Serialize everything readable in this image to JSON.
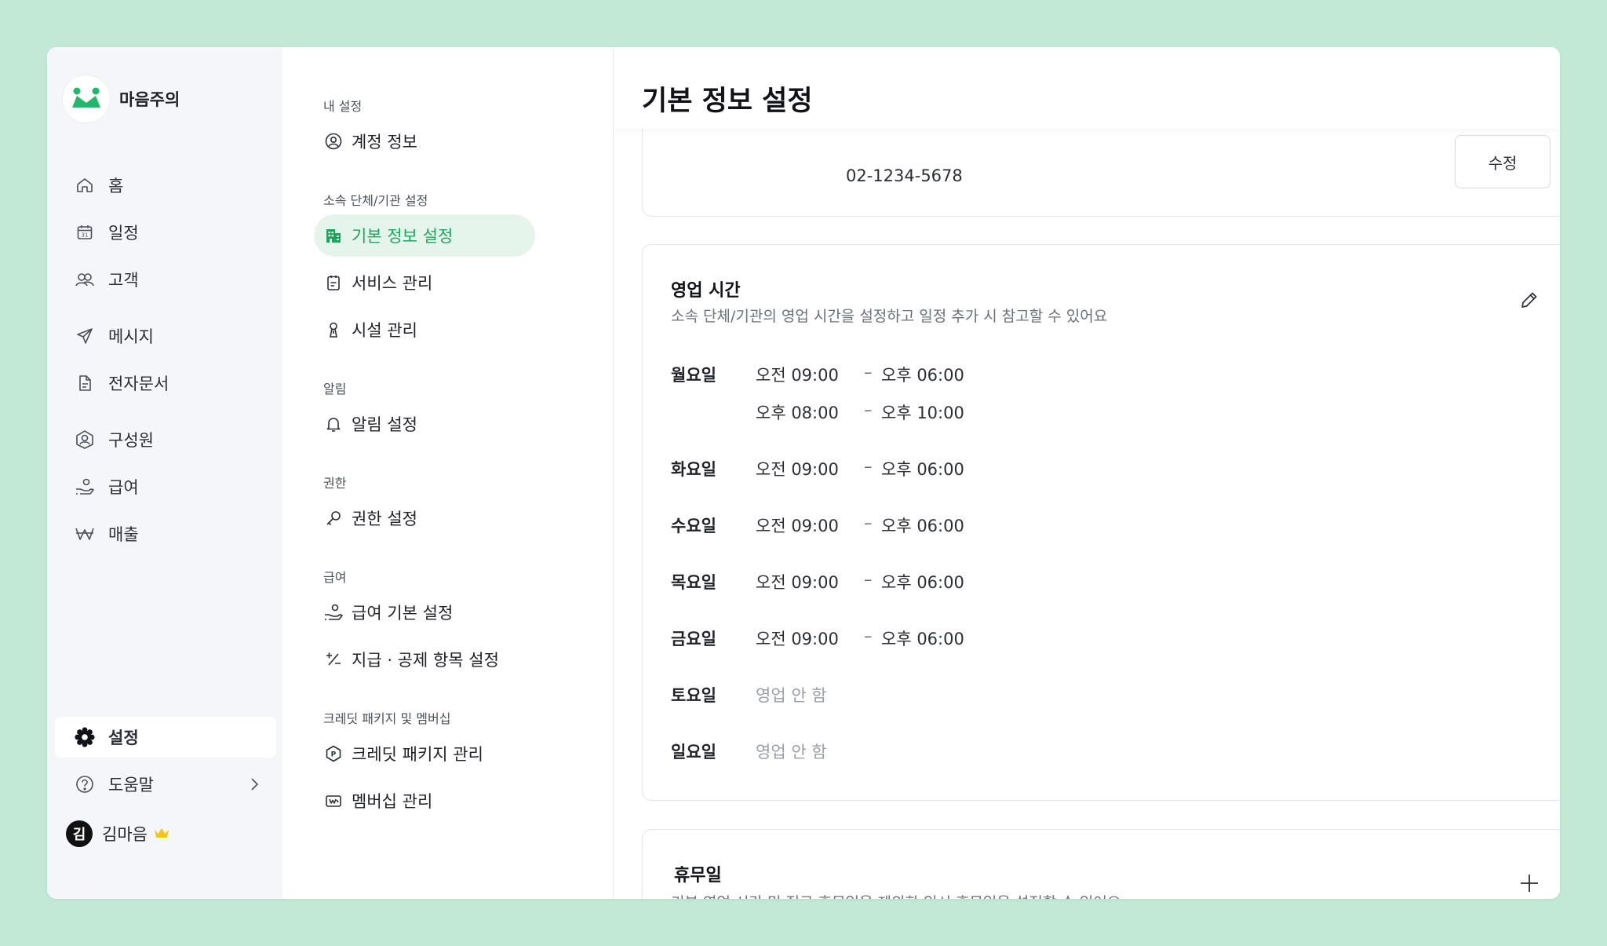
{
  "brand": {
    "name": "마음주의"
  },
  "sidebar": {
    "items": [
      {
        "label": "홈",
        "icon": "home-icon"
      },
      {
        "label": "일정",
        "icon": "calendar-icon"
      },
      {
        "label": "고객",
        "icon": "customers-icon"
      },
      {
        "label": "메시지",
        "icon": "send-icon"
      },
      {
        "label": "전자문서",
        "icon": "document-icon"
      },
      {
        "label": "구성원",
        "icon": "members-icon"
      },
      {
        "label": "급여",
        "icon": "payroll-icon"
      },
      {
        "label": "매출",
        "icon": "won-icon"
      }
    ],
    "settings_label": "설정",
    "help_label": "도움말",
    "user": {
      "avatar_text": "김",
      "name": "김마음"
    }
  },
  "subnav": {
    "groups": [
      {
        "title": "내 설정",
        "items": [
          "계정 정보"
        ]
      },
      {
        "title": "소속 단체/기관 설정",
        "items": [
          "기본 정보 설정",
          "서비스 관리",
          "시설 관리"
        ]
      },
      {
        "title": "알림",
        "items": [
          "알림 설정"
        ]
      },
      {
        "title": "권한",
        "items": [
          "권한 설정"
        ]
      },
      {
        "title": "급여",
        "items": [
          "급여 기본 설정",
          "지급 · 공제 항목 설정"
        ]
      },
      {
        "title": "크레딧 패키지 및 멤버십",
        "items": [
          "크레딧 패키지 관리",
          "멤버십 관리"
        ]
      }
    ],
    "active": "기본 정보 설정"
  },
  "main": {
    "title": "기본 정보 설정",
    "phone": {
      "value": "02-1234-5678",
      "edit_label": "수정"
    },
    "hours": {
      "title": "영업 시간",
      "description": "소속 단체/기관의 영업 시간을 설정하고 일정 추가 시 참고할 수 있어요",
      "dash": "–",
      "days": [
        {
          "day": "월요일",
          "slots": [
            {
              "start": "오전 09:00",
              "end": "오후 06:00"
            },
            {
              "start": "오후 08:00",
              "end": "오후 10:00"
            }
          ]
        },
        {
          "day": "화요일",
          "slots": [
            {
              "start": "오전 09:00",
              "end": "오후 06:00"
            }
          ]
        },
        {
          "day": "수요일",
          "slots": [
            {
              "start": "오전 09:00",
              "end": "오후 06:00"
            }
          ]
        },
        {
          "day": "목요일",
          "slots": [
            {
              "start": "오전 09:00",
              "end": "오후 06:00"
            }
          ]
        },
        {
          "day": "금요일",
          "slots": [
            {
              "start": "오전 09:00",
              "end": "오후 06:00"
            }
          ]
        },
        {
          "day": "토요일",
          "closed": "영업 안 함"
        },
        {
          "day": "일요일",
          "closed": "영업 안 함"
        }
      ]
    },
    "holiday": {
      "title": "휴무일",
      "description": "기본 영업 시간 및 정규 휴무일을 제외한 임시 휴무일을 설정할 수 있어요"
    }
  },
  "colors": {
    "background": "#c2e9d5",
    "accent": "#1ba65a",
    "active_bg": "#e6f5ec",
    "crown": "#f5c518"
  }
}
